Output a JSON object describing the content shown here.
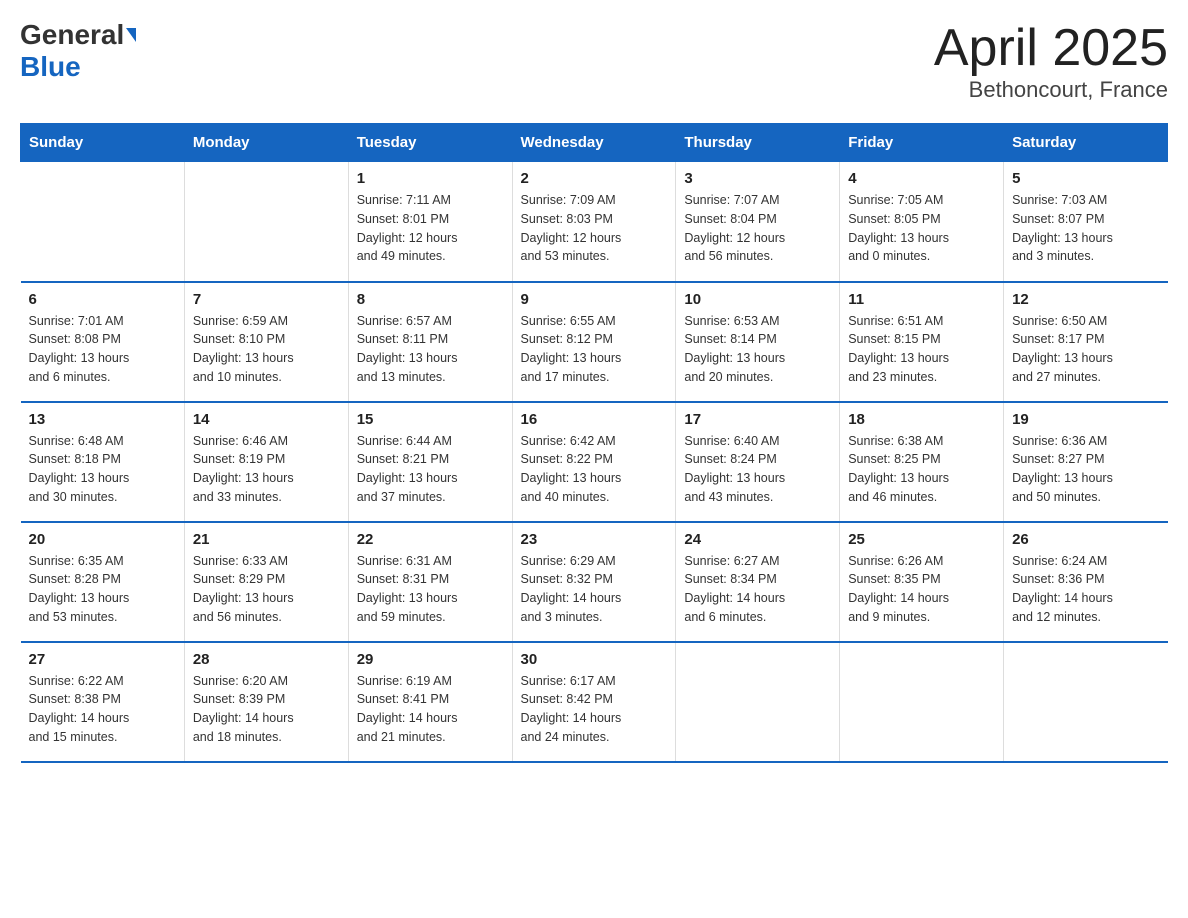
{
  "logo": {
    "general": "General",
    "blue": "Blue"
  },
  "title": "April 2025",
  "subtitle": "Bethoncourt, France",
  "weekdays": [
    "Sunday",
    "Monday",
    "Tuesday",
    "Wednesday",
    "Thursday",
    "Friday",
    "Saturday"
  ],
  "weeks": [
    [
      {
        "day": "",
        "info": ""
      },
      {
        "day": "",
        "info": ""
      },
      {
        "day": "1",
        "info": "Sunrise: 7:11 AM\nSunset: 8:01 PM\nDaylight: 12 hours\nand 49 minutes."
      },
      {
        "day": "2",
        "info": "Sunrise: 7:09 AM\nSunset: 8:03 PM\nDaylight: 12 hours\nand 53 minutes."
      },
      {
        "day": "3",
        "info": "Sunrise: 7:07 AM\nSunset: 8:04 PM\nDaylight: 12 hours\nand 56 minutes."
      },
      {
        "day": "4",
        "info": "Sunrise: 7:05 AM\nSunset: 8:05 PM\nDaylight: 13 hours\nand 0 minutes."
      },
      {
        "day": "5",
        "info": "Sunrise: 7:03 AM\nSunset: 8:07 PM\nDaylight: 13 hours\nand 3 minutes."
      }
    ],
    [
      {
        "day": "6",
        "info": "Sunrise: 7:01 AM\nSunset: 8:08 PM\nDaylight: 13 hours\nand 6 minutes."
      },
      {
        "day": "7",
        "info": "Sunrise: 6:59 AM\nSunset: 8:10 PM\nDaylight: 13 hours\nand 10 minutes."
      },
      {
        "day": "8",
        "info": "Sunrise: 6:57 AM\nSunset: 8:11 PM\nDaylight: 13 hours\nand 13 minutes."
      },
      {
        "day": "9",
        "info": "Sunrise: 6:55 AM\nSunset: 8:12 PM\nDaylight: 13 hours\nand 17 minutes."
      },
      {
        "day": "10",
        "info": "Sunrise: 6:53 AM\nSunset: 8:14 PM\nDaylight: 13 hours\nand 20 minutes."
      },
      {
        "day": "11",
        "info": "Sunrise: 6:51 AM\nSunset: 8:15 PM\nDaylight: 13 hours\nand 23 minutes."
      },
      {
        "day": "12",
        "info": "Sunrise: 6:50 AM\nSunset: 8:17 PM\nDaylight: 13 hours\nand 27 minutes."
      }
    ],
    [
      {
        "day": "13",
        "info": "Sunrise: 6:48 AM\nSunset: 8:18 PM\nDaylight: 13 hours\nand 30 minutes."
      },
      {
        "day": "14",
        "info": "Sunrise: 6:46 AM\nSunset: 8:19 PM\nDaylight: 13 hours\nand 33 minutes."
      },
      {
        "day": "15",
        "info": "Sunrise: 6:44 AM\nSunset: 8:21 PM\nDaylight: 13 hours\nand 37 minutes."
      },
      {
        "day": "16",
        "info": "Sunrise: 6:42 AM\nSunset: 8:22 PM\nDaylight: 13 hours\nand 40 minutes."
      },
      {
        "day": "17",
        "info": "Sunrise: 6:40 AM\nSunset: 8:24 PM\nDaylight: 13 hours\nand 43 minutes."
      },
      {
        "day": "18",
        "info": "Sunrise: 6:38 AM\nSunset: 8:25 PM\nDaylight: 13 hours\nand 46 minutes."
      },
      {
        "day": "19",
        "info": "Sunrise: 6:36 AM\nSunset: 8:27 PM\nDaylight: 13 hours\nand 50 minutes."
      }
    ],
    [
      {
        "day": "20",
        "info": "Sunrise: 6:35 AM\nSunset: 8:28 PM\nDaylight: 13 hours\nand 53 minutes."
      },
      {
        "day": "21",
        "info": "Sunrise: 6:33 AM\nSunset: 8:29 PM\nDaylight: 13 hours\nand 56 minutes."
      },
      {
        "day": "22",
        "info": "Sunrise: 6:31 AM\nSunset: 8:31 PM\nDaylight: 13 hours\nand 59 minutes."
      },
      {
        "day": "23",
        "info": "Sunrise: 6:29 AM\nSunset: 8:32 PM\nDaylight: 14 hours\nand 3 minutes."
      },
      {
        "day": "24",
        "info": "Sunrise: 6:27 AM\nSunset: 8:34 PM\nDaylight: 14 hours\nand 6 minutes."
      },
      {
        "day": "25",
        "info": "Sunrise: 6:26 AM\nSunset: 8:35 PM\nDaylight: 14 hours\nand 9 minutes."
      },
      {
        "day": "26",
        "info": "Sunrise: 6:24 AM\nSunset: 8:36 PM\nDaylight: 14 hours\nand 12 minutes."
      }
    ],
    [
      {
        "day": "27",
        "info": "Sunrise: 6:22 AM\nSunset: 8:38 PM\nDaylight: 14 hours\nand 15 minutes."
      },
      {
        "day": "28",
        "info": "Sunrise: 6:20 AM\nSunset: 8:39 PM\nDaylight: 14 hours\nand 18 minutes."
      },
      {
        "day": "29",
        "info": "Sunrise: 6:19 AM\nSunset: 8:41 PM\nDaylight: 14 hours\nand 21 minutes."
      },
      {
        "day": "30",
        "info": "Sunrise: 6:17 AM\nSunset: 8:42 PM\nDaylight: 14 hours\nand 24 minutes."
      },
      {
        "day": "",
        "info": ""
      },
      {
        "day": "",
        "info": ""
      },
      {
        "day": "",
        "info": ""
      }
    ]
  ]
}
